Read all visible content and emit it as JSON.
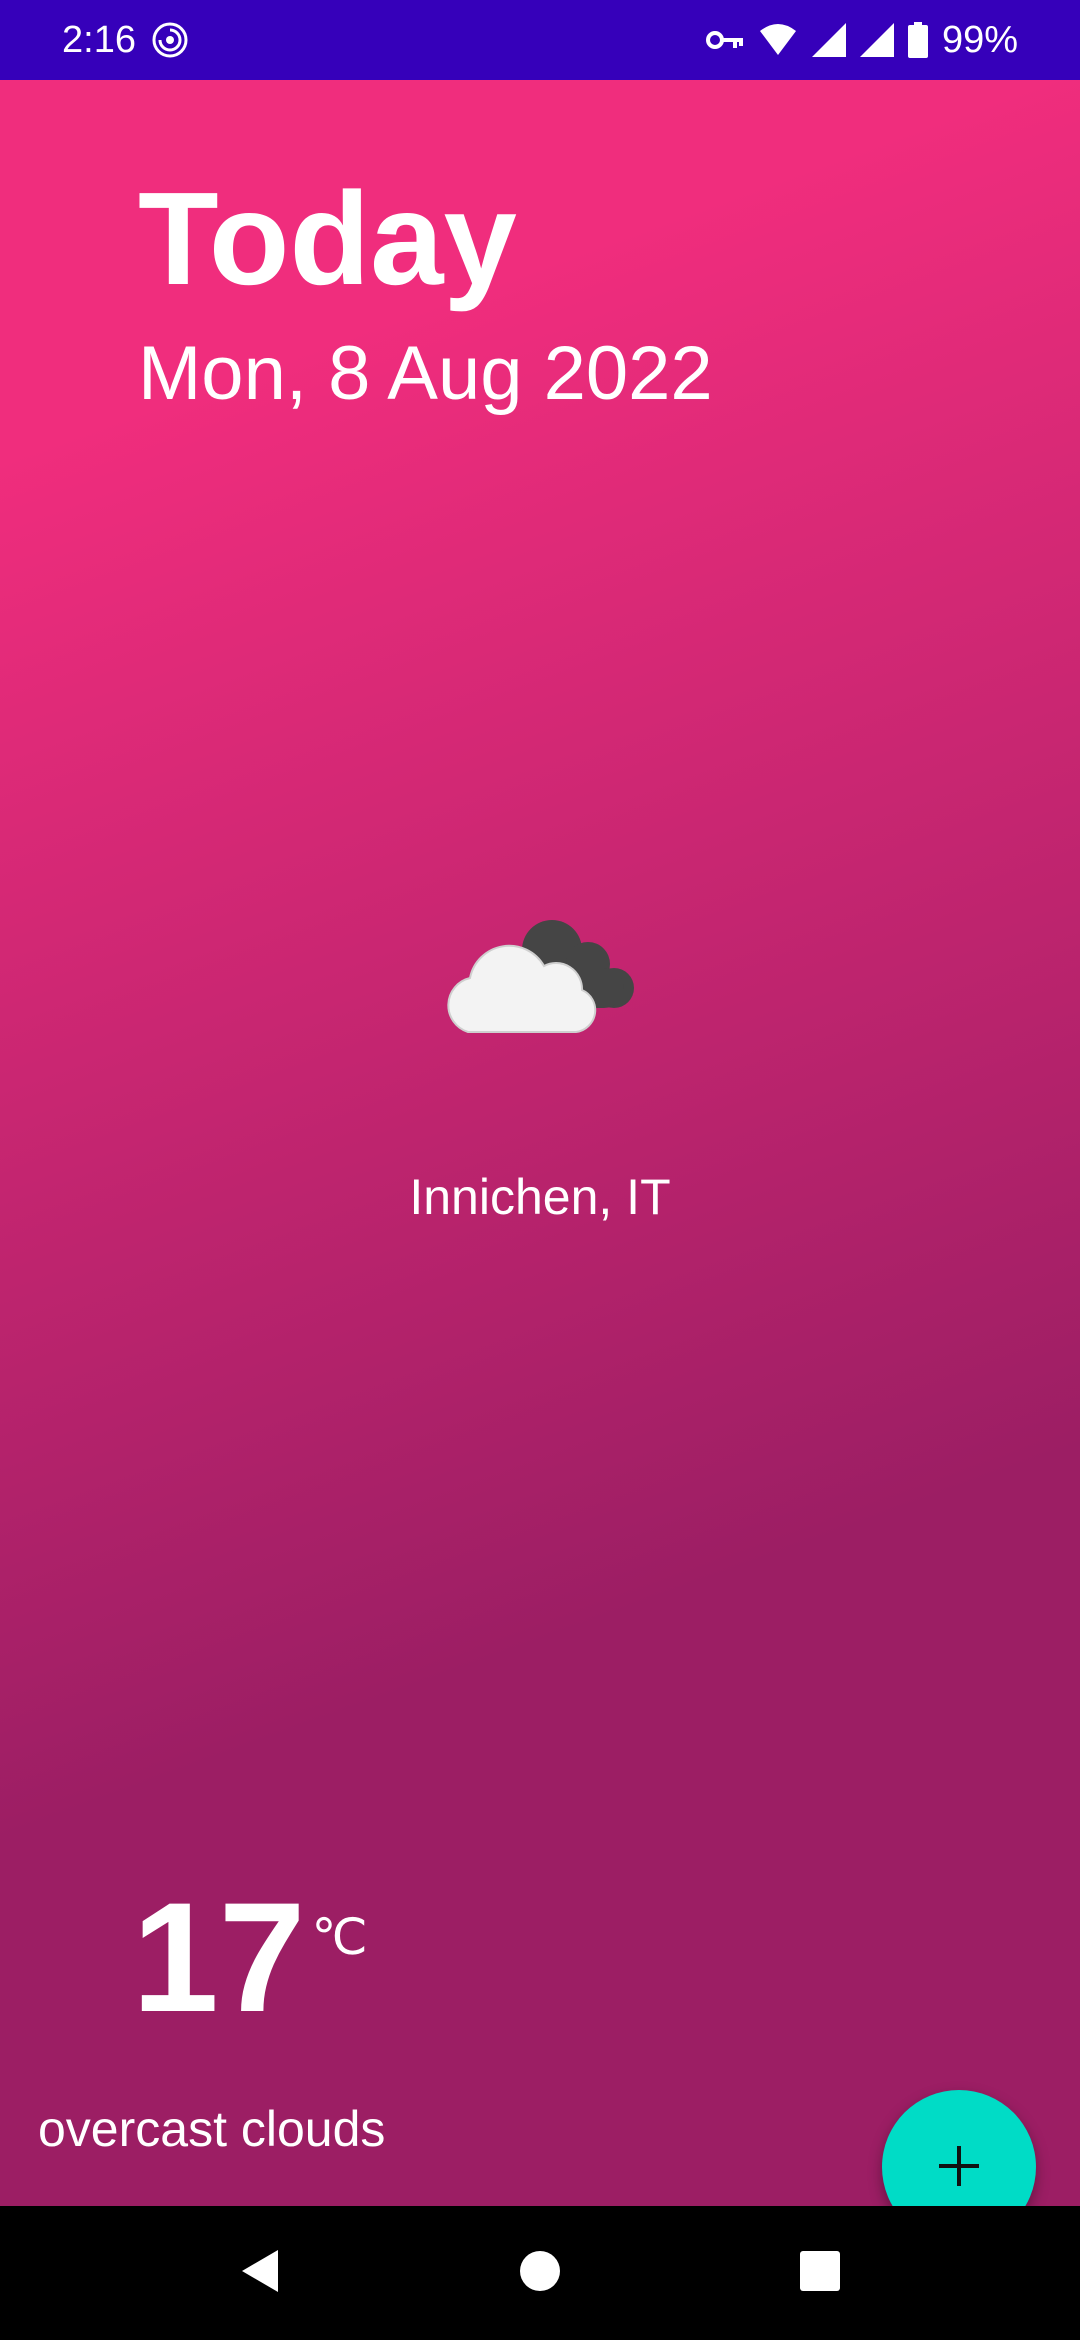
{
  "status_bar": {
    "time": "2:16",
    "battery": "99%",
    "icons": [
      "data-saver-icon",
      "vpn-key-icon",
      "wifi-icon",
      "signal-icon",
      "signal-icon",
      "battery-icon"
    ]
  },
  "header": {
    "title": "Today",
    "date": "Mon, 8 Aug 2022"
  },
  "weather": {
    "icon": "overcast-clouds-icon",
    "location": "Innichen, IT",
    "temperature": "17",
    "unit": "℃",
    "condition": "overcast clouds"
  },
  "fab": {
    "icon": "plus-icon"
  },
  "nav_bar": {
    "icons": [
      "back-icon",
      "home-icon",
      "recents-icon"
    ]
  },
  "colors": {
    "status_bar": "#3600BA",
    "gradient_start": "#F02D7D",
    "gradient_end": "#9C1E64",
    "fab": "#00DCC6",
    "nav_bar": "#000000",
    "text": "#FFFFFF"
  }
}
